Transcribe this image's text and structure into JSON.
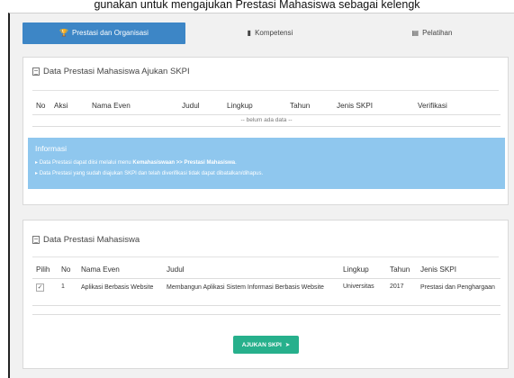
{
  "caption": "gunakan untuk mengajukan Prestasi Mahasiswa sebagai kelengk",
  "tabs": [
    {
      "label": "Prestasi dan Organisasi",
      "icon": "trophy-icon",
      "active": true
    },
    {
      "label": "Kompetensi",
      "icon": "book-icon",
      "active": false
    },
    {
      "label": "Pelatihan",
      "icon": "list-icon",
      "active": false
    }
  ],
  "ajukan": {
    "title": "Data Prestasi Mahasiswa Ajukan SKPI",
    "columns": [
      "No",
      "Aksi",
      "Nama Even",
      "Judul",
      "Lingkup",
      "Tahun",
      "Jenis SKPI",
      "Verifikasi"
    ],
    "empty_text": "-- belum ada data --"
  },
  "info": {
    "title": "Informasi",
    "line1_prefix": "Data Prestasi dapat diisi melalui menu ",
    "line1_bold": "Kemahasiswaan >> Prestasi Mahasiswa",
    "line1_suffix": ".",
    "line2": "Data Prestasi yang sudah diajukan SKPI dan telah diverifikasi tidak dapat dibatalkan/dihapus."
  },
  "prestasi": {
    "title": "Data Prestasi Mahasiswa",
    "columns": [
      "Pilih",
      "No",
      "Nama Even",
      "Judul",
      "Lingkup",
      "Tahun",
      "Jenis SKPI"
    ],
    "rows": [
      {
        "checked": true,
        "check_mark": "✓",
        "no": "1",
        "nama_even": "Aplikasi Berbasis Website",
        "judul": "Membangun Aplikasi Sistem Informasi Berbasis Website",
        "lingkup": "Universitas",
        "tahun": "2017",
        "jenis_skpi": "Prestasi dan Penghargaan"
      }
    ]
  },
  "submit": {
    "label": "AJUKAN SKPI",
    "icon": "send-icon"
  },
  "colors": {
    "tab_active": "#3d86c6",
    "info_bg": "#8fc7ee",
    "submit_bg": "#27b08c"
  }
}
